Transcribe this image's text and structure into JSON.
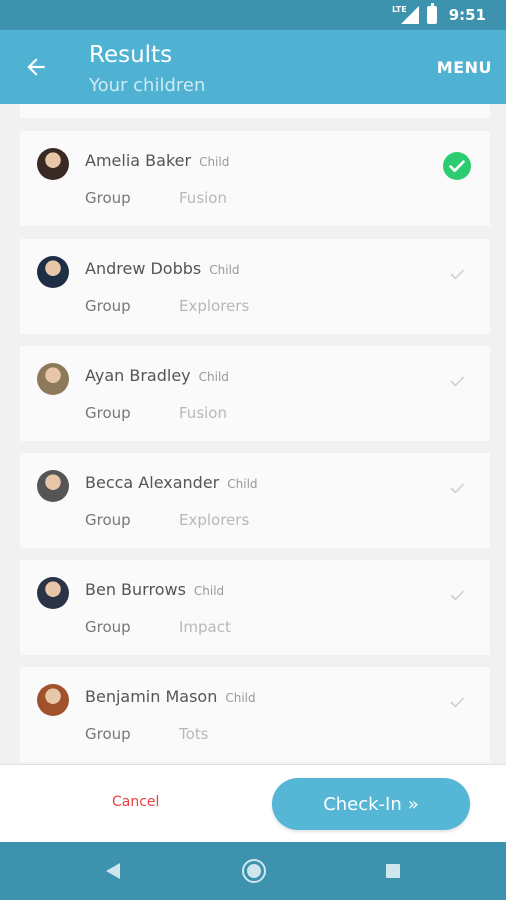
{
  "status_bar": {
    "network": "LTE",
    "time": "9:51"
  },
  "app_bar": {
    "title": "Results",
    "subtitle": "Your children",
    "menu_label": "MENU"
  },
  "children": [
    {
      "name": "Amelia Baker",
      "role": "Child",
      "group_label": "Group",
      "group": "Fusion",
      "checked": true,
      "avatar_color": "#3a2a26"
    },
    {
      "name": "Andrew Dobbs",
      "role": "Child",
      "group_label": "Group",
      "group": "Explorers",
      "checked": false,
      "avatar_color": "#1e2e44"
    },
    {
      "name": "Ayan Bradley",
      "role": "Child",
      "group_label": "Group",
      "group": "Fusion",
      "checked": false,
      "avatar_color": "#8c7a5a"
    },
    {
      "name": "Becca Alexander",
      "role": "Child",
      "group_label": "Group",
      "group": "Explorers",
      "checked": false,
      "avatar_color": "#555555"
    },
    {
      "name": "Ben Burrows",
      "role": "Child",
      "group_label": "Group",
      "group": "Impact",
      "checked": false,
      "avatar_color": "#2b3346"
    },
    {
      "name": "Benjamin Mason",
      "role": "Child",
      "group_label": "Group",
      "group": "Tots",
      "checked": false,
      "avatar_color": "#a0522d"
    }
  ],
  "footer": {
    "cancel_label": "Cancel",
    "checkin_label": "Check-In",
    "checkin_chevron": "»"
  },
  "colors": {
    "accent": "#4fb2d3",
    "status": "#3d93ad",
    "checked": "#2ecc71",
    "cancel": "#e8403c"
  }
}
